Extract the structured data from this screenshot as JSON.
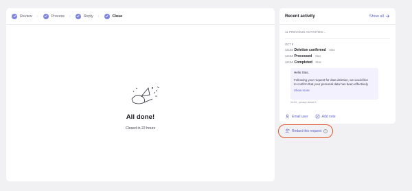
{
  "steps": [
    {
      "label": "Review",
      "active": false
    },
    {
      "label": "Process",
      "active": false
    },
    {
      "label": "Reply",
      "active": false
    },
    {
      "label": "Close",
      "active": true
    }
  ],
  "done": {
    "title": "All done!",
    "subtitle": "Closed in 22 hours"
  },
  "activity": {
    "title": "Recent activity",
    "show_all": "Show all",
    "previous": "11 PREVIOUS ACTIVITIES...",
    "date": "OCT 8",
    "events": [
      {
        "time": "14:24",
        "name": "Deletion confirmed",
        "actor": "· Stas"
      },
      {
        "time": "14:24",
        "name": "Processed",
        "actor": "· Stas"
      },
      {
        "time": "14:24",
        "name": "Completed",
        "actor": "· Stas"
      }
    ],
    "message": {
      "greeting": "Hello Stas,",
      "line1": "Following your request for data deletion, we would like",
      "line2": "to confirm that your personal data has been effectively",
      "show_more": "Show more",
      "meta": "14:24 · privacy above.0"
    },
    "actions": {
      "email": "Email user",
      "note": "Add note"
    }
  },
  "redact": {
    "label": "Redact this request",
    "info": "i"
  },
  "colors": {
    "accent": "#5a5ec8",
    "step_check": "#7d84e2",
    "highlight_ring": "#e0582c",
    "message_bg": "#f3f1fd"
  }
}
